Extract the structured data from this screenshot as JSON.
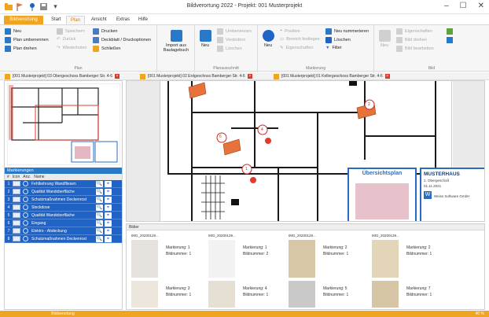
{
  "window": {
    "title": "Bildverortung 2022 - Projekt: 001 Musterprojekt",
    "controls": [
      "–",
      "☐",
      "✕"
    ]
  },
  "quick_access": [
    "folder-icon",
    "flag-icon",
    "pin-icon",
    "save-icon",
    "dropdown-icon"
  ],
  "ribbon_tabs": {
    "file": "Bildverortung",
    "tabs": [
      "Start",
      "Plan",
      "Ansicht",
      "Extras",
      "Hilfe"
    ],
    "active": "Plan"
  },
  "ribbon": {
    "plan_group": {
      "label": "Plan",
      "items": [
        "Neu",
        "Plan umbenennen",
        "Plan drehen",
        "Speichern",
        "Zurück",
        "Wiederholen",
        "Drucken",
        "Deckblatt / Druckoptionen",
        "Schließen"
      ]
    },
    "import": {
      "label": "Import aus Bautagebuch"
    },
    "planausschnitt": {
      "label": "Planausschnitt",
      "neu": "Neu",
      "items": [
        "Umbenennen",
        "Verändern",
        "Löschen"
      ]
    },
    "markierung": {
      "label": "Markierung",
      "neu": "Neu",
      "items": [
        "Position",
        "Bereich festlegen",
        "Eigenschaften",
        "Neu nummerieren",
        "Löschen",
        "Filter"
      ]
    },
    "bild": {
      "label": "Bild",
      "neu": "Neu",
      "items": [
        "Eigenschaften",
        "Bild drehen",
        "Bild bearbeiten"
      ]
    }
  },
  "doc_tabs": [
    "[001 Musterprojekt] 03 Obergeschoss Bamberger Str. 4-6",
    "[001 Musterprojekt] 02 Erdgeschoss Bamberger Str. 4-6",
    "[001 Musterprojekt] 01 Kellergeschoss Bamberger Str. 4-6"
  ],
  "markierungen": {
    "header": "Markierungen",
    "columns": [
      "#",
      "Icon",
      "Anz.",
      "Name"
    ],
    "rows": [
      {
        "num": "1",
        "name": "Fehlbohrung Wandfliesen"
      },
      {
        "num": "2",
        "name": "Qualität Wandoberfläche"
      },
      {
        "num": "3",
        "name": "Schutzmaßnahmen Deckenrost"
      },
      {
        "num": "4",
        "name": "Steckdose"
      },
      {
        "num": "5",
        "name": "Qualität Wandoberfläche"
      },
      {
        "num": "6",
        "name": "Eingang"
      },
      {
        "num": "7",
        "name": "Elektro - Abdeckung"
      },
      {
        "num": "8",
        "name": "Schutzmaßnahmen Deckenrost"
      }
    ]
  },
  "plan_overview": {
    "title": "Übersichtsplan",
    "musterhaus": "MUSTERHAUS",
    "floor": "1. Obergeschoß",
    "date": "01.11.2021",
    "company": "Weiss Software GmbH",
    "callouts": [
      "1",
      "2",
      "4",
      "6"
    ]
  },
  "bilder": {
    "header": "Bilder",
    "marker_label": "Markierung:",
    "image_label": "Bildnummer:",
    "items": [
      {
        "file": "IMG_20200129...",
        "marker": "1",
        "image": "1"
      },
      {
        "file": "IMG_20200129...",
        "marker": "1",
        "image": "2"
      },
      {
        "file": "IMG_20200129...",
        "marker": "2",
        "image": "1"
      },
      {
        "file": "IMG_20200129...",
        "marker": "2",
        "image": "1"
      },
      {
        "file": "",
        "marker": "3",
        "image": "1"
      },
      {
        "file": "",
        "marker": "4",
        "image": "1"
      },
      {
        "file": "",
        "marker": "5",
        "image": "1"
      },
      {
        "file": "",
        "marker": "7",
        "image": "1"
      }
    ]
  },
  "status": {
    "center": "Bildverortung",
    "right": "40 %"
  },
  "colors": {
    "accent": "#f0a522",
    "blue": "#1f63c6",
    "marker_red": "#e23b2e",
    "flag": "#e8733a"
  }
}
